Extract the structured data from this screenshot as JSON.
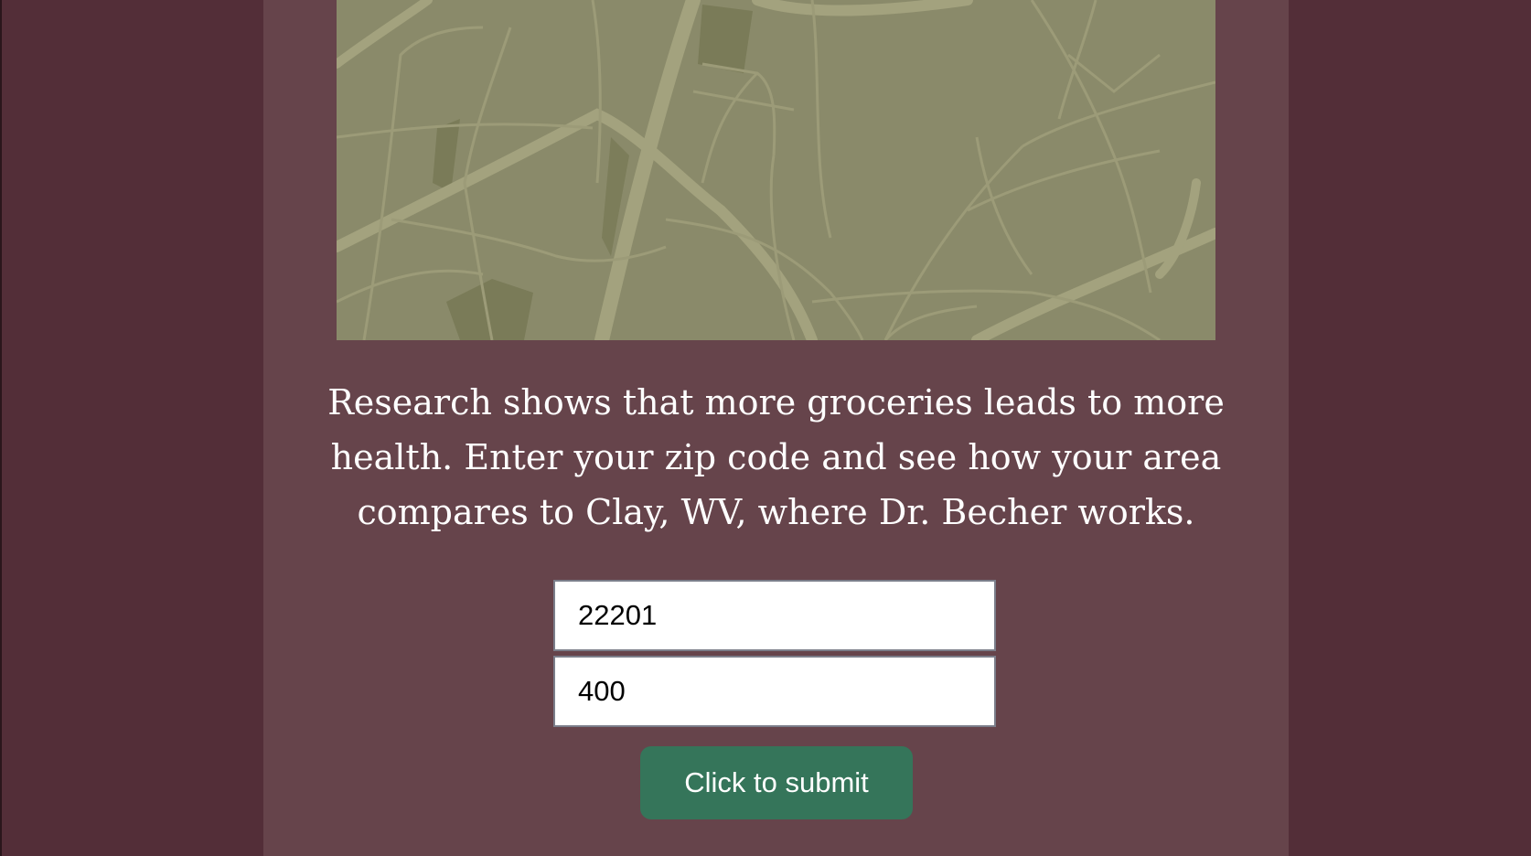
{
  "intro": {
    "text": "Research shows that more groceries leads to more health. Enter your zip code and see how your area compares to Clay, WV, where Dr. Becher works."
  },
  "form": {
    "zip_value": "22201",
    "distance_value": "400",
    "submit_label": "Click to submit"
  },
  "colors": {
    "page_background": "#532e38",
    "panel_background": "#66444b",
    "map_background": "#8a8a6a",
    "submit_button": "#35755a"
  }
}
